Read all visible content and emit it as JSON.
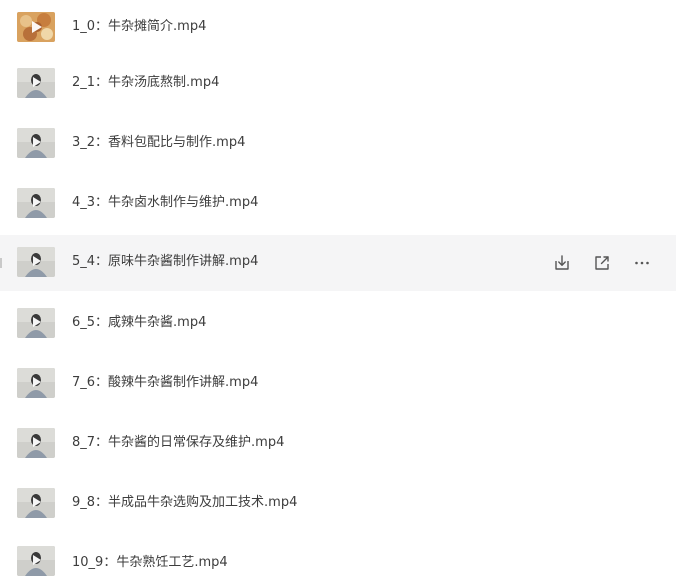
{
  "files": [
    {
      "name": "1_0：牛杂摊简介.mp4",
      "thumb": "food-thumbnail"
    },
    {
      "name": "2_1：牛杂汤底熬制.mp4",
      "thumb": "person-thumbnail"
    },
    {
      "name": "3_2：香料包配比与制作.mp4",
      "thumb": "person-thumbnail"
    },
    {
      "name": "4_3：牛杂卤水制作与维护.mp4",
      "thumb": "person-thumbnail"
    },
    {
      "name": "5_4：原味牛杂酱制作讲解.mp4",
      "thumb": "person-thumbnail",
      "hovered": true
    },
    {
      "name": "6_5：咸辣牛杂酱.mp4",
      "thumb": "person-thumbnail"
    },
    {
      "name": "7_6：酸辣牛杂酱制作讲解.mp4",
      "thumb": "person-thumbnail"
    },
    {
      "name": "8_7：牛杂酱的日常保存及维护.mp4",
      "thumb": "person-thumbnail"
    },
    {
      "name": "9_8：半成品牛杂选购及加工技术.mp4",
      "thumb": "person-thumbnail"
    },
    {
      "name": "10_9：牛杂熟饪工艺.mp4",
      "thumb": "person-thumbnail"
    }
  ],
  "hover_actions": {
    "download_icon": "download-icon",
    "share_icon": "share-icon",
    "more_icon": "more-icon"
  },
  "colors": {
    "hover_background": "#f5f5f6",
    "text": "#3d3d3d",
    "icon": "#555555"
  }
}
